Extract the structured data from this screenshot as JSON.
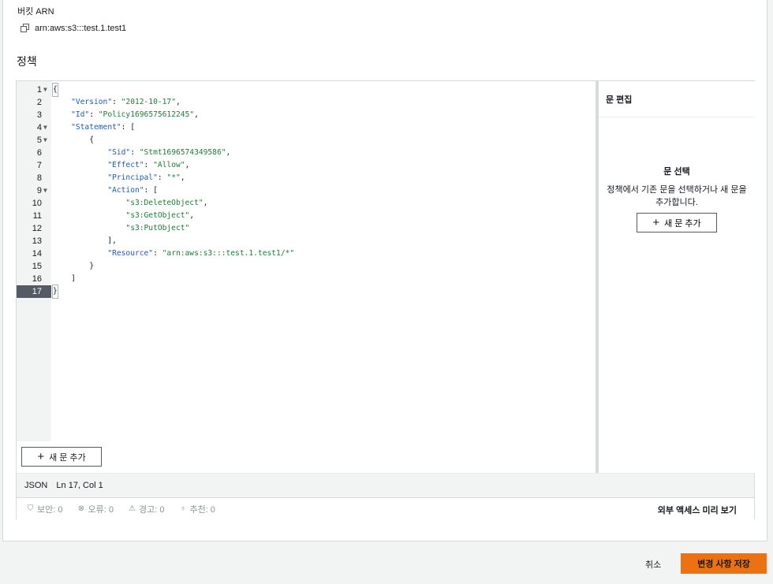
{
  "bucket": {
    "arn_label": "버킷 ARN",
    "arn_value": "arn:aws:s3:::test.1.test1"
  },
  "policy": {
    "section_title": "정책"
  },
  "code_lines": [
    {
      "n": "1",
      "fold": true,
      "text": "{"
    },
    {
      "n": "2",
      "fold": false,
      "key": "\"Version\"",
      "sep": ": ",
      "val": "\"2012-10-17\"",
      "end": ",",
      "indent": "    "
    },
    {
      "n": "3",
      "fold": false,
      "key": "\"Id\"",
      "sep": ": ",
      "val": "\"Policy1696575612245\"",
      "end": ",",
      "indent": "    "
    },
    {
      "n": "4",
      "fold": true,
      "key": "\"Statement\"",
      "sep": ": ",
      "val": "",
      "end": "[",
      "indent": "    "
    },
    {
      "n": "5",
      "fold": true,
      "text": "        {"
    },
    {
      "n": "6",
      "fold": false,
      "key": "\"Sid\"",
      "sep": ": ",
      "val": "\"Stmt1696574349586\"",
      "end": ",",
      "indent": "            "
    },
    {
      "n": "7",
      "fold": false,
      "key": "\"Effect\"",
      "sep": ": ",
      "val": "\"Allow\"",
      "end": ",",
      "indent": "            "
    },
    {
      "n": "8",
      "fold": false,
      "key": "\"Principal\"",
      "sep": ": ",
      "val": "\"*\"",
      "end": ",",
      "indent": "            "
    },
    {
      "n": "9",
      "fold": true,
      "key": "\"Action\"",
      "sep": ": ",
      "val": "",
      "end": "[",
      "indent": "            "
    },
    {
      "n": "10",
      "fold": false,
      "key": "",
      "sep": "",
      "val": "\"s3:DeleteObject\"",
      "end": ",",
      "indent": "                "
    },
    {
      "n": "11",
      "fold": false,
      "key": "",
      "sep": "",
      "val": "\"s3:GetObject\"",
      "end": ",",
      "indent": "                "
    },
    {
      "n": "12",
      "fold": false,
      "key": "",
      "sep": "",
      "val": "\"s3:PutObject\"",
      "end": "",
      "indent": "                "
    },
    {
      "n": "13",
      "fold": false,
      "text": "            ],"
    },
    {
      "n": "14",
      "fold": false,
      "key": "\"Resource\"",
      "sep": ": ",
      "val": "\"arn:aws:s3:::test.1.test1/*\"",
      "end": "",
      "indent": "            "
    },
    {
      "n": "15",
      "fold": false,
      "text": "        }"
    },
    {
      "n": "16",
      "fold": false,
      "text": "    ]"
    },
    {
      "n": "17",
      "fold": false,
      "text": "}",
      "active": true
    }
  ],
  "editor": {
    "add_statement_label": "새 문 추가",
    "status_mode": "JSON",
    "status_position": "Ln 17, Col 1"
  },
  "side_panel": {
    "header": "문 편집",
    "title": "문 선택",
    "description": "정책에서 기존 문을 선택하거나 새 문을 추가합니다.",
    "add_statement_label": "새 문 추가"
  },
  "validation": {
    "security": "보안: 0",
    "errors": "오류: 0",
    "warnings": "경고: 0",
    "suggestions": "추천: 0",
    "preview_link": "외부 액세스 미리 보기"
  },
  "footer": {
    "cancel_label": "취소",
    "save_label": "변경 사항 저장"
  },
  "colors": {
    "accent": "#ec7211",
    "key": "#1d5bbf",
    "string": "#1a7f37"
  }
}
